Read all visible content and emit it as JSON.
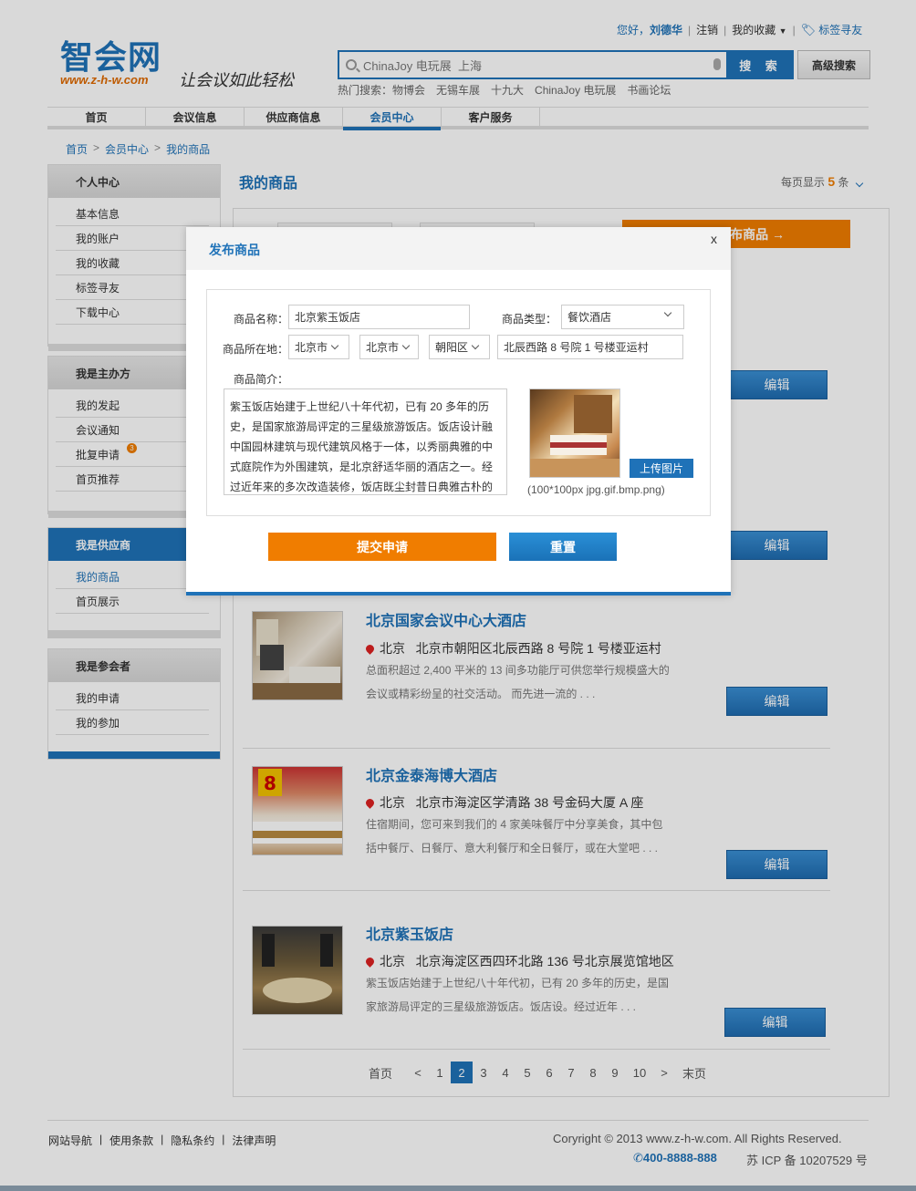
{
  "header": {
    "logo_text": "智会网",
    "logo_url": "www.z-h-w.com",
    "slogan": "让会议如此轻松",
    "top_links": {
      "greeting": "您好，",
      "username": "刘德华",
      "logout": "注销",
      "favorites": "我的收藏",
      "tag_search": "标签寻友"
    },
    "search": {
      "value": "ChinaJoy 电玩展  上海",
      "button": "搜 索",
      "advanced": "高级搜索"
    },
    "hot": {
      "label": "热门搜索：物博会",
      "items": [
        "无锡车展",
        "十九大",
        "ChinaJoy 电玩展",
        "书画论坛"
      ]
    }
  },
  "nav": [
    "首页",
    "会议信息",
    "供应商信息",
    "会员中心",
    "客户服务"
  ],
  "breadcrumb": [
    "首页",
    "会员中心",
    "我的商品"
  ],
  "sidebar": [
    {
      "title": "个人中心",
      "items": [
        "基本信息",
        "我的账户",
        "我的收藏",
        "标签寻友",
        "下载中心"
      ]
    },
    {
      "title": "我是主办方",
      "items": [
        "我的发起",
        "会议通知",
        "批复申请",
        "首页推荐"
      ],
      "badge": "3"
    },
    {
      "title": "我是供应商",
      "items": [
        "我的商品",
        "首页展示"
      ]
    },
    {
      "title": "我是参会者",
      "items": [
        "我的申请",
        "我的参加"
      ]
    }
  ],
  "main": {
    "title": "我的商品",
    "per_page_label": "每页显示",
    "per_page_value": "5",
    "per_page_unit": "条",
    "publish_button": "发布商品 →",
    "edit_label": "编辑",
    "items": [
      {
        "title": "北京国家会议中心大酒店",
        "city": "北京",
        "address": "北京市朝阳区北辰西路 8 号院 1 号楼亚运村",
        "desc": "总面积超过 2,400 平米的 13 间多功能厅可供您举行规模盛大的会议或精彩纷呈的社交活动。 而先进一流的 . . ."
      },
      {
        "title": "北京金泰海博大酒店",
        "city": "北京",
        "address": "北京市海淀区学清路 38 号金码大厦 A 座",
        "desc": "住宿期间，您可来到我们的 4 家美味餐厅中分享美食，其中包括中餐厅、日餐厅、意大利餐厅和全日餐厅，或在大堂吧 . . ."
      },
      {
        "title": "北京紫玉饭店",
        "city": "北京",
        "address": "北京海淀区西四环北路 136 号北京展览馆地区",
        "desc": "紫玉饭店始建于上世纪八十年代初，已有 20 多年的历史，是国家旅游局评定的三星级旅游饭店。饭店设。经过近年 . . ."
      }
    ],
    "pager": [
      "首页",
      "<",
      "1",
      "2",
      "3",
      "4",
      "5",
      "6",
      "7",
      "8",
      "9",
      "10",
      ">",
      "末页"
    ],
    "pager_current": "2"
  },
  "modal": {
    "title": "发布商品",
    "close": "x",
    "name_label": "商品名称：",
    "name_value": "北京紫玉饭店",
    "type_label": "商品类型：",
    "type_value": "餐饮酒店",
    "loc_label": "商品所在地：",
    "province": "北京市",
    "city": "北京市",
    "district": "朝阳区",
    "address_value": "北辰西路 8 号院 1 号楼亚运村",
    "intro_label": "商品简介：",
    "intro_value": "紫玉饭店始建于上世纪八十年代初，已有 20 多年的历史，是国家旅游局评定的三星级旅游饭店。饭店设计融中国园林建筑与现代建筑风格于一体，以秀丽典雅的中式庭院作为外围建筑，是北京舒适华丽的酒店之一。经过近年来的多次改造装修，饭店既尘封昔日典雅古朴的庄重 . . .",
    "upload": "上传图片",
    "img_tip": "(100*100px jpg.gif.bmp.png)",
    "submit": "提交申请",
    "reset": "重置"
  },
  "footer": {
    "links": [
      "网站导航",
      "使用条款",
      "隐私条约",
      "法律声明"
    ],
    "copyright": "Coryright © 2013 www.z-h-w.com. All Rights Reserved.",
    "phone": "400-8888-888",
    "icp": "苏 ICP 备 10207529 号"
  }
}
